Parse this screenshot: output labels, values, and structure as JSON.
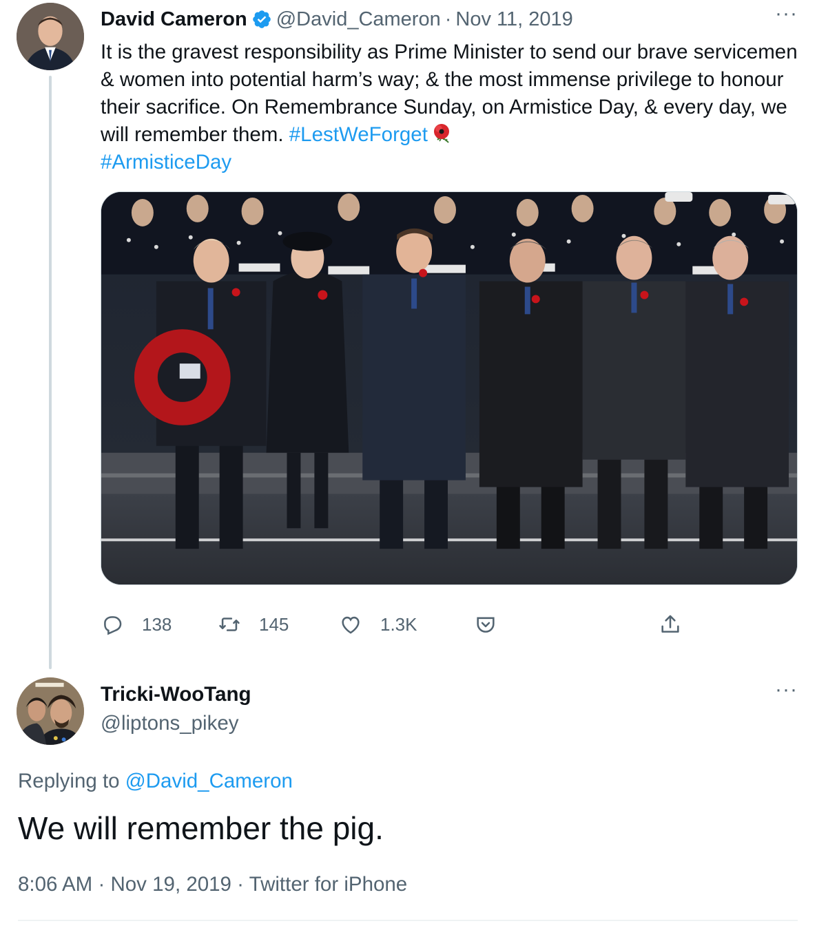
{
  "thread_parent": {
    "author_name": "David Cameron",
    "handle": "@David_Cameron",
    "date": "Nov 11, 2019",
    "separator": "·",
    "verified": true,
    "text_plain": "It is the gravest responsibility as Prime Minister to send our brave servicemen & women into potential harm’s way; & the most immense privilege to honour their sacrifice. On Remembrance Sunday, on Armistice Day, & every day, we will remember them.",
    "hashtag_1": "#LestWeForget",
    "hashtag_2": "#ArmisticeDay",
    "emoji": "poppy-icon",
    "more_label": "···",
    "media_description": "remembrance-ceremony-photo",
    "stats": {
      "replies": "138",
      "retweets": "145",
      "likes": "1.3K"
    }
  },
  "reply": {
    "author_name": "Tricki-WooTang",
    "handle": "@liptons_pikey",
    "more_label": "···",
    "replying_prefix": "Replying to",
    "replying_to": "@David_Cameron",
    "text": "We will remember the pig.",
    "time": "8:06 AM",
    "date": "Nov 19, 2019",
    "source": "Twitter for iPhone",
    "separator": "·"
  },
  "colors": {
    "link": "#1d9bf0",
    "muted": "#536471",
    "text": "#0f1419",
    "verified": "#1d9bf0"
  }
}
